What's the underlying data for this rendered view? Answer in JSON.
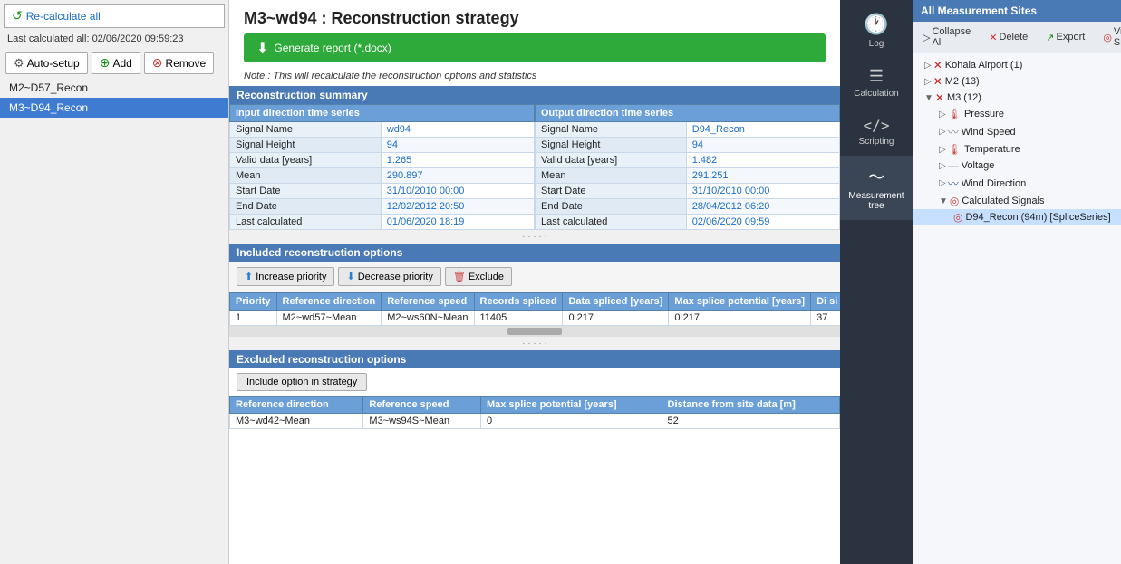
{
  "sidebar": {
    "recalc_label": "Re-calculate all",
    "last_calc_label": "Last calculated all:",
    "last_calc_value": "02/06/2020 09:59:23",
    "auto_setup_label": "Auto-setup",
    "add_label": "Add",
    "remove_label": "Remove",
    "items": [
      {
        "id": "M2~D57_Recon",
        "label": "M2~D57_Recon",
        "selected": false
      },
      {
        "id": "M3~D94_Recon",
        "label": "M3~D94_Recon",
        "selected": true
      }
    ]
  },
  "main": {
    "title": "M3~wd94 : Reconstruction strategy",
    "report_btn_label": "Generate report (*.docx)",
    "note": "Note : This will recalculate the reconstruction options and statistics",
    "recon_summary_header": "Reconstruction summary",
    "input_header": "Input direction time series",
    "output_header": "Output direction time series",
    "input_rows": [
      {
        "label": "Signal Name",
        "value": "wd94"
      },
      {
        "label": "Signal Height",
        "value": "94"
      },
      {
        "label": "Valid data [years]",
        "value": "1.265"
      },
      {
        "label": "Mean",
        "value": "290.897"
      },
      {
        "label": "Start Date",
        "value": "31/10/2010 00:00"
      },
      {
        "label": "End Date",
        "value": "12/02/2012 20:50"
      },
      {
        "label": "Last calculated",
        "value": "01/06/2020 18:19"
      }
    ],
    "output_rows": [
      {
        "label": "Signal Name",
        "value": "D94_Recon"
      },
      {
        "label": "Signal Height",
        "value": "94"
      },
      {
        "label": "Valid data [years]",
        "value": "1.482"
      },
      {
        "label": "Mean",
        "value": "291.251"
      },
      {
        "label": "Start Date",
        "value": "31/10/2010 00:00"
      },
      {
        "label": "End Date",
        "value": "28/04/2012 06:20"
      },
      {
        "label": "Last calculated",
        "value": "02/06/2020 09:59"
      }
    ],
    "included_header": "Included reconstruction options",
    "increase_priority_label": "Increase priority",
    "decrease_priority_label": "Decrease priority",
    "exclude_label": "Exclude",
    "included_columns": [
      "Priority",
      "Reference direction",
      "Reference speed",
      "Records spliced",
      "Data spliced [years]",
      "Max splice potential [years]",
      "Di si [n"
    ],
    "included_rows": [
      {
        "priority": "1",
        "ref_dir": "M2~wd57~Mean",
        "ref_speed": "M2~ws60N~Mean",
        "records": "11405",
        "data_spliced": "0.217",
        "max_splice": "0.217",
        "di_si": "37"
      }
    ],
    "excluded_header": "Excluded reconstruction options",
    "include_option_label": "Include option in strategy",
    "excluded_columns": [
      "Reference direction",
      "Reference speed",
      "Max splice potential [years]",
      "Distance from site data [m]"
    ],
    "excluded_rows": [
      {
        "ref_dir": "M3~wd42~Mean",
        "ref_speed": "M3~ws94S~Mean",
        "max_splice": "0",
        "distance": "52"
      }
    ]
  },
  "right_panel": {
    "header": "All Measurement Sites",
    "toolbar": {
      "collapse_all": "Collapse All",
      "delete": "Delete",
      "export": "Export",
      "view_signal": "View Signal"
    },
    "nav_items": [
      {
        "id": "log",
        "label": "Log",
        "icon": "🕐"
      },
      {
        "id": "calculation",
        "label": "Calculation",
        "icon": "≡"
      },
      {
        "id": "scripting",
        "label": "Scripting",
        "icon": "</>"
      },
      {
        "id": "measurement_tree",
        "label": "Measurement tree",
        "icon": "〜"
      }
    ],
    "tree": {
      "nodes": [
        {
          "id": "kohala",
          "label": "Kohala Airport (1)",
          "level": 0,
          "type": "site",
          "expanded": false
        },
        {
          "id": "m2",
          "label": "M2 (13)",
          "level": 0,
          "type": "site",
          "expanded": false
        },
        {
          "id": "m3",
          "label": "M3 (12)",
          "level": 0,
          "type": "site",
          "expanded": true
        },
        {
          "id": "pressure",
          "label": "Pressure",
          "level": 1,
          "type": "pressure",
          "expanded": false
        },
        {
          "id": "wind_speed",
          "label": "Wind Speed",
          "level": 1,
          "type": "wind_speed",
          "expanded": false
        },
        {
          "id": "temperature",
          "label": "Temperature",
          "level": 1,
          "type": "temperature",
          "expanded": false
        },
        {
          "id": "voltage",
          "label": "Voltage",
          "level": 1,
          "type": "voltage",
          "expanded": false
        },
        {
          "id": "wind_direction",
          "label": "Wind Direction",
          "level": 1,
          "type": "wind_direction",
          "expanded": true
        },
        {
          "id": "calculated_signals",
          "label": "Calculated Signals",
          "level": 1,
          "type": "calculated",
          "expanded": true
        },
        {
          "id": "d94_recon",
          "label": "D94_Recon (94m) [SpliceSeries]",
          "level": 2,
          "type": "splice",
          "selected": true
        }
      ]
    }
  }
}
